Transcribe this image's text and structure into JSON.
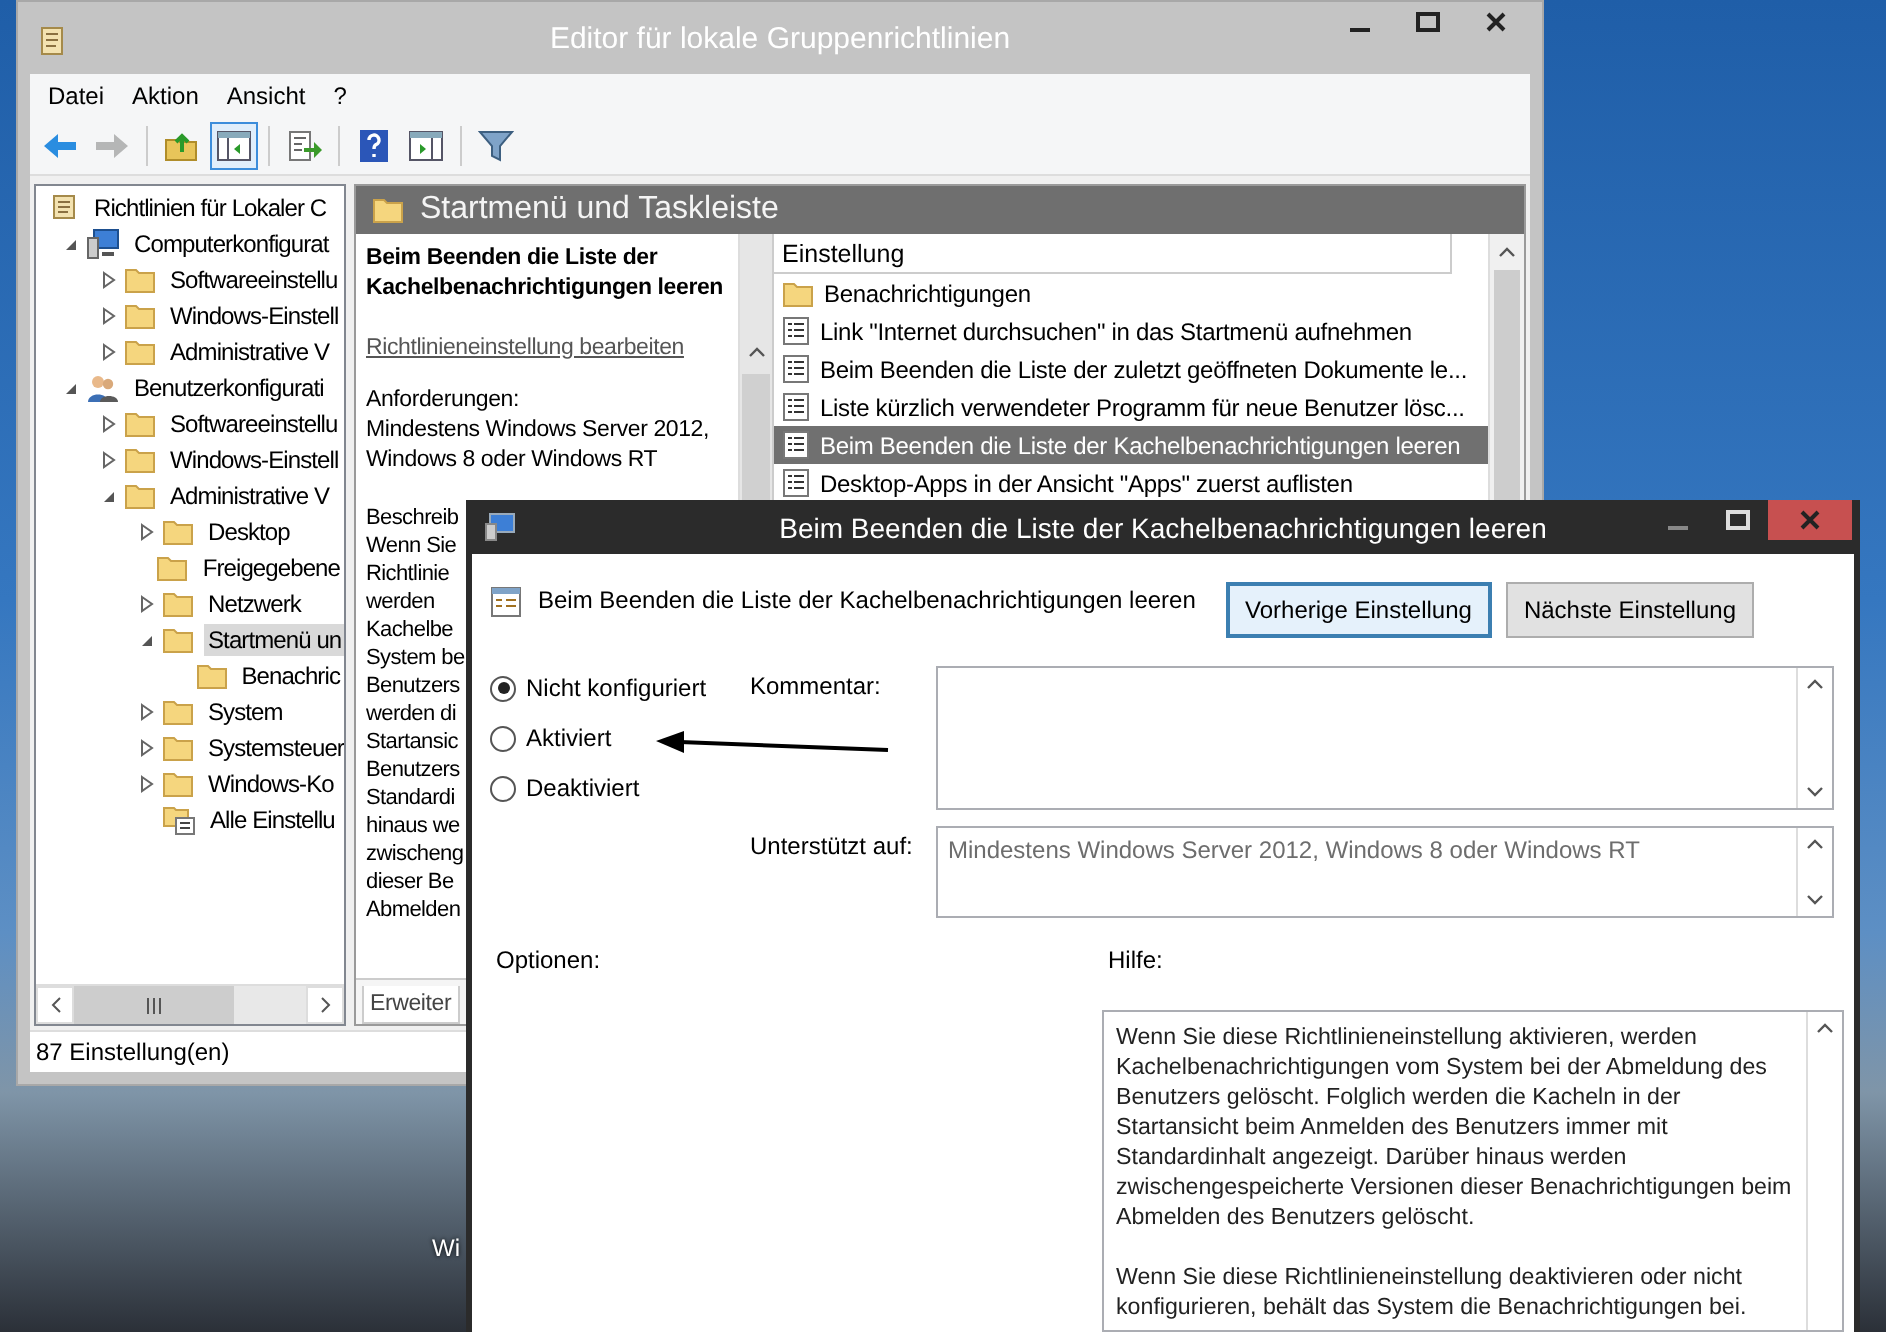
{
  "desktop": {
    "icon_label": "Wi"
  },
  "main_window": {
    "title": "Editor für lokale Gruppenrichtlinien",
    "menu": [
      "Datei",
      "Aktion",
      "Ansicht",
      "?"
    ],
    "toolbar": [
      {
        "kind": "back",
        "pressed": false,
        "disabled": false
      },
      {
        "kind": "forward",
        "pressed": false,
        "disabled": true
      },
      {
        "kind": "up",
        "pressed": false,
        "disabled": false
      },
      {
        "kind": "tree-toggle",
        "pressed": true,
        "disabled": false
      },
      {
        "kind": "export",
        "pressed": false,
        "disabled": false
      },
      {
        "kind": "help",
        "pressed": false,
        "disabled": false
      },
      {
        "kind": "pane-toggle",
        "pressed": false,
        "disabled": false
      },
      {
        "kind": "filter",
        "pressed": false,
        "disabled": false
      }
    ],
    "tree": [
      {
        "label": "Richtlinien für Lokaler C",
        "kind": "root",
        "selected": false,
        "children": [
          {
            "label": "Computerkonfigurat",
            "kind": "computer",
            "expanded": true,
            "selected": false,
            "children": [
              {
                "label": "Softwareeinstellu",
                "kind": "folder",
                "expanded": false,
                "selected": false
              },
              {
                "label": "Windows-Einstell",
                "kind": "folder",
                "expanded": false,
                "selected": false
              },
              {
                "label": "Administrative V",
                "kind": "folder",
                "expanded": false,
                "selected": false
              }
            ]
          },
          {
            "label": "Benutzerkonfigurati",
            "kind": "user",
            "expanded": true,
            "selected": false,
            "children": [
              {
                "label": "Softwareeinstellu",
                "kind": "folder",
                "expanded": false,
                "selected": false
              },
              {
                "label": "Windows-Einstell",
                "kind": "folder",
                "expanded": false,
                "selected": false
              },
              {
                "label": "Administrative V",
                "kind": "folder",
                "expanded": true,
                "selected": false,
                "children": [
                  {
                    "label": "Desktop",
                    "kind": "folder",
                    "expanded": false,
                    "selected": false
                  },
                  {
                    "label": "Freigegebene",
                    "kind": "folder",
                    "selected": false
                  },
                  {
                    "label": "Netzwerk",
                    "kind": "folder",
                    "expanded": false,
                    "selected": false
                  },
                  {
                    "label": "Startmenü un",
                    "kind": "folder",
                    "expanded": true,
                    "selected": true,
                    "children": [
                      {
                        "label": "Benachric",
                        "kind": "folder",
                        "selected": false
                      }
                    ]
                  },
                  {
                    "label": "System",
                    "kind": "folder",
                    "expanded": false,
                    "selected": false
                  },
                  {
                    "label": "Systemsteuer",
                    "kind": "folder",
                    "expanded": false,
                    "selected": false
                  },
                  {
                    "label": "Windows-Ko",
                    "kind": "folder",
                    "expanded": false,
                    "selected": false
                  },
                  {
                    "label": "Alle Einstellu",
                    "kind": "all-settings",
                    "selected": false
                  }
                ]
              }
            ]
          }
        ]
      }
    ],
    "header": "Startmenü und Taskleiste",
    "description": {
      "title": "Beim Beenden die Liste der\nKachelbenachrichtigungen leeren",
      "edit_link": "Richtlinieneinstellung bearbeiten",
      "requirements_label": "Anforderungen:",
      "requirements": "Mindestens Windows Server 2012,\nWindows 8 oder Windows RT",
      "lines": [
        "Beschreib",
        "Wenn Sie",
        "Richtlinie",
        "werden",
        "Kachelbe",
        "System be",
        "Benutzers",
        "werden di",
        "Startansic",
        "Benutzers",
        "Standardi",
        "hinaus we",
        "zwischeng",
        "dieser Be",
        "Abmelden"
      ]
    },
    "tabs": [
      {
        "label": "Erweiter",
        "selected": true
      }
    ],
    "list": {
      "columns": [
        "Einstellung"
      ],
      "rows": [
        {
          "kind": "folder",
          "label": "Benachrichtigungen",
          "selected": false
        },
        {
          "kind": "setting",
          "label": "Link \"Internet durchsuchen\" in das Startmenü aufnehmen",
          "selected": false
        },
        {
          "kind": "setting",
          "label": "Beim Beenden die Liste der zuletzt geöffneten Dokumente le...",
          "selected": false
        },
        {
          "kind": "setting",
          "label": "Liste kürzlich verwendeter Programm für neue Benutzer lösc...",
          "selected": false
        },
        {
          "kind": "setting",
          "label": "Beim Beenden die Liste der Kachelbenachrichtigungen leeren",
          "selected": true
        },
        {
          "kind": "setting",
          "label": "Desktop-Apps in der Ansicht \"Apps\" zuerst auflisten",
          "selected": false
        }
      ]
    },
    "status_bar": "87 Einstellung(en)"
  },
  "dialog": {
    "title": "Beim Beenden die Liste der Kachelbenachrichtigungen leeren",
    "setting_name": "Beim Beenden die Liste der Kachelbenachrichtigungen leeren",
    "buttons": [
      {
        "label": "Vorherige Einstellung",
        "focused": true
      },
      {
        "label": "Nächste Einstellung",
        "focused": false
      }
    ],
    "options": [
      {
        "label": "Nicht konfiguriert",
        "selected": true
      },
      {
        "label": "Aktiviert",
        "selected": false
      },
      {
        "label": "Deaktiviert",
        "selected": false
      }
    ],
    "comment_label": "Kommentar:",
    "supported_label": "Unterstützt auf:",
    "supported_on": "Mindestens Windows Server 2012, Windows 8 oder Windows RT",
    "options_label": "Optionen:",
    "help_label": "Hilfe:",
    "help_paragraphs": [
      "Wenn Sie diese Richtlinieneinstellung aktivieren, werden Kachelbenachrichtigungen vom System bei der Abmeldung des Benutzers gelöscht. Folglich werden die Kacheln in der Startansicht beim Anmelden des Benutzers immer mit Standardinhalt angezeigt. Darüber hinaus werden zwischengespeicherte Versionen dieser Benachrichtigungen beim Abmelden des Benutzers gelöscht.",
      "Wenn Sie diese Richtlinieneinstellung deaktivieren oder nicht konfigurieren, behält das System die Benachrichtigungen bei."
    ]
  }
}
